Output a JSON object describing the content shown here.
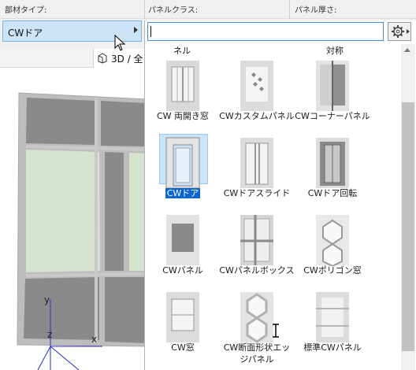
{
  "header": {
    "member_type_label": "部材タイプ:",
    "panel_class_label": "パネルクラス:",
    "panel_thickness_label": "パネル厚さ:"
  },
  "member_type": {
    "value": "CWドア"
  },
  "search": {
    "value": "",
    "placeholder": ""
  },
  "viewport": {
    "tab_label": "3D / 全",
    "axes": {
      "x": "x",
      "y": "y",
      "z": "z"
    }
  },
  "gallery": {
    "partial_labels": [
      "ネル",
      "対称"
    ],
    "selected_index": 3,
    "items": [
      {
        "label": "CW 両開き窓",
        "icon": "double-casement-window-icon"
      },
      {
        "label": "CWカスタムパネル",
        "icon": "custom-panel-icon"
      },
      {
        "label": "CWコーナーパネル",
        "icon": "corner-panel-icon"
      },
      {
        "label": "CWドア",
        "icon": "door-icon"
      },
      {
        "label": "CWドアスライド",
        "icon": "sliding-door-icon"
      },
      {
        "label": "CWドア回転",
        "icon": "revolving-door-icon"
      },
      {
        "label": "CWパネル",
        "icon": "panel-icon"
      },
      {
        "label": "CWパネルボックス",
        "icon": "panel-box-icon"
      },
      {
        "label": "CWポリゴン窓",
        "icon": "polygon-window-icon"
      },
      {
        "label": "CW窓",
        "icon": "window-icon"
      },
      {
        "label": "CW断面形状エッ",
        "label2": "ジパネル",
        "icon": "profile-edge-panel-icon"
      },
      {
        "label": "標準CWパネル",
        "icon": "standard-panel-icon"
      }
    ]
  }
}
